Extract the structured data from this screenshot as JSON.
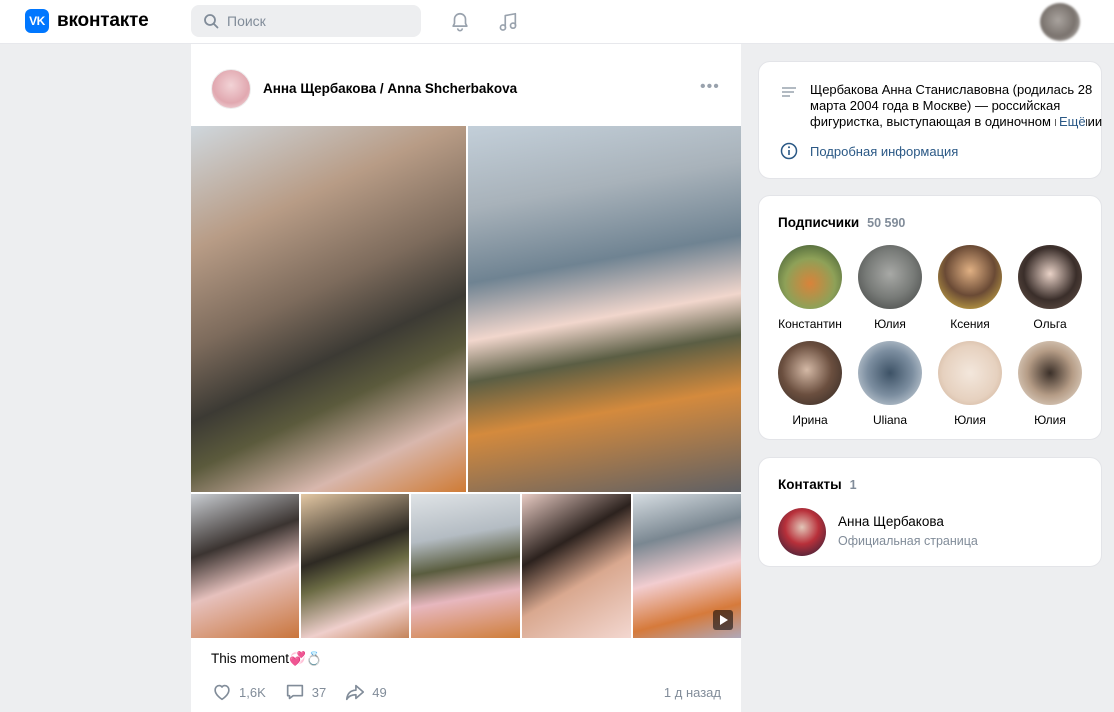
{
  "header": {
    "logo_mark": "VK",
    "logo_text": "вконтакте",
    "search_placeholder": "Поиск"
  },
  "post": {
    "author": "Анна Щербакова / Anna Shcherbakova",
    "more": "•••",
    "text": "This moment💞💍",
    "likes": "1,6K",
    "comments": "37",
    "shares": "49",
    "date": "1 д назад"
  },
  "about": {
    "text": "Щербакова Анна Станиславовна (родилась 28 марта 2004 года в Москве) — российская фигуристка, выступающая в одиночном катании",
    "more_label": "Ещё",
    "details_label": "Подробная информация"
  },
  "subscribers": {
    "title": "Подписчики",
    "count": "50 590",
    "items": [
      {
        "name": "Константин"
      },
      {
        "name": "Юлия"
      },
      {
        "name": "Ксения"
      },
      {
        "name": "Ольга"
      },
      {
        "name": "Ирина"
      },
      {
        "name": "Uliana"
      },
      {
        "name": "Юлия"
      },
      {
        "name": "Юлия"
      }
    ]
  },
  "contacts": {
    "title": "Контакты",
    "count": "1",
    "name": "Анна Щербакова",
    "subtitle": "Официальная страница"
  },
  "colors": {
    "accent": "#0077ff",
    "link": "#2a5885",
    "muted": "#818c99",
    "background": "#edeef0"
  }
}
